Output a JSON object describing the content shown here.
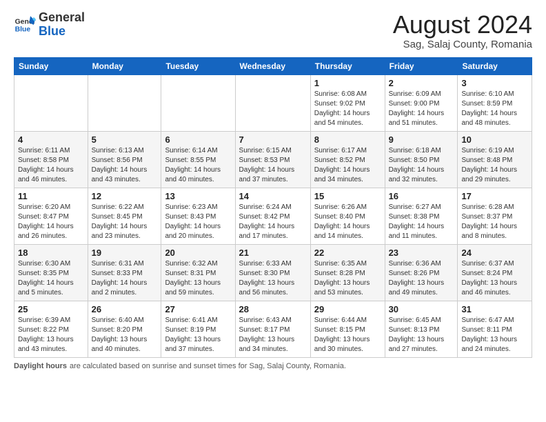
{
  "header": {
    "logo_general": "General",
    "logo_blue": "Blue",
    "month_year": "August 2024",
    "location": "Sag, Salaj County, Romania"
  },
  "days_of_week": [
    "Sunday",
    "Monday",
    "Tuesday",
    "Wednesday",
    "Thursday",
    "Friday",
    "Saturday"
  ],
  "weeks": [
    [
      {
        "day": "",
        "info": ""
      },
      {
        "day": "",
        "info": ""
      },
      {
        "day": "",
        "info": ""
      },
      {
        "day": "",
        "info": ""
      },
      {
        "day": "1",
        "info": "Sunrise: 6:08 AM\nSunset: 9:02 PM\nDaylight: 14 hours and 54 minutes."
      },
      {
        "day": "2",
        "info": "Sunrise: 6:09 AM\nSunset: 9:00 PM\nDaylight: 14 hours and 51 minutes."
      },
      {
        "day": "3",
        "info": "Sunrise: 6:10 AM\nSunset: 8:59 PM\nDaylight: 14 hours and 48 minutes."
      }
    ],
    [
      {
        "day": "4",
        "info": "Sunrise: 6:11 AM\nSunset: 8:58 PM\nDaylight: 14 hours and 46 minutes."
      },
      {
        "day": "5",
        "info": "Sunrise: 6:13 AM\nSunset: 8:56 PM\nDaylight: 14 hours and 43 minutes."
      },
      {
        "day": "6",
        "info": "Sunrise: 6:14 AM\nSunset: 8:55 PM\nDaylight: 14 hours and 40 minutes."
      },
      {
        "day": "7",
        "info": "Sunrise: 6:15 AM\nSunset: 8:53 PM\nDaylight: 14 hours and 37 minutes."
      },
      {
        "day": "8",
        "info": "Sunrise: 6:17 AM\nSunset: 8:52 PM\nDaylight: 14 hours and 34 minutes."
      },
      {
        "day": "9",
        "info": "Sunrise: 6:18 AM\nSunset: 8:50 PM\nDaylight: 14 hours and 32 minutes."
      },
      {
        "day": "10",
        "info": "Sunrise: 6:19 AM\nSunset: 8:48 PM\nDaylight: 14 hours and 29 minutes."
      }
    ],
    [
      {
        "day": "11",
        "info": "Sunrise: 6:20 AM\nSunset: 8:47 PM\nDaylight: 14 hours and 26 minutes."
      },
      {
        "day": "12",
        "info": "Sunrise: 6:22 AM\nSunset: 8:45 PM\nDaylight: 14 hours and 23 minutes."
      },
      {
        "day": "13",
        "info": "Sunrise: 6:23 AM\nSunset: 8:43 PM\nDaylight: 14 hours and 20 minutes."
      },
      {
        "day": "14",
        "info": "Sunrise: 6:24 AM\nSunset: 8:42 PM\nDaylight: 14 hours and 17 minutes."
      },
      {
        "day": "15",
        "info": "Sunrise: 6:26 AM\nSunset: 8:40 PM\nDaylight: 14 hours and 14 minutes."
      },
      {
        "day": "16",
        "info": "Sunrise: 6:27 AM\nSunset: 8:38 PM\nDaylight: 14 hours and 11 minutes."
      },
      {
        "day": "17",
        "info": "Sunrise: 6:28 AM\nSunset: 8:37 PM\nDaylight: 14 hours and 8 minutes."
      }
    ],
    [
      {
        "day": "18",
        "info": "Sunrise: 6:30 AM\nSunset: 8:35 PM\nDaylight: 14 hours and 5 minutes."
      },
      {
        "day": "19",
        "info": "Sunrise: 6:31 AM\nSunset: 8:33 PM\nDaylight: 14 hours and 2 minutes."
      },
      {
        "day": "20",
        "info": "Sunrise: 6:32 AM\nSunset: 8:31 PM\nDaylight: 13 hours and 59 minutes."
      },
      {
        "day": "21",
        "info": "Sunrise: 6:33 AM\nSunset: 8:30 PM\nDaylight: 13 hours and 56 minutes."
      },
      {
        "day": "22",
        "info": "Sunrise: 6:35 AM\nSunset: 8:28 PM\nDaylight: 13 hours and 53 minutes."
      },
      {
        "day": "23",
        "info": "Sunrise: 6:36 AM\nSunset: 8:26 PM\nDaylight: 13 hours and 49 minutes."
      },
      {
        "day": "24",
        "info": "Sunrise: 6:37 AM\nSunset: 8:24 PM\nDaylight: 13 hours and 46 minutes."
      }
    ],
    [
      {
        "day": "25",
        "info": "Sunrise: 6:39 AM\nSunset: 8:22 PM\nDaylight: 13 hours and 43 minutes."
      },
      {
        "day": "26",
        "info": "Sunrise: 6:40 AM\nSunset: 8:20 PM\nDaylight: 13 hours and 40 minutes."
      },
      {
        "day": "27",
        "info": "Sunrise: 6:41 AM\nSunset: 8:19 PM\nDaylight: 13 hours and 37 minutes."
      },
      {
        "day": "28",
        "info": "Sunrise: 6:43 AM\nSunset: 8:17 PM\nDaylight: 13 hours and 34 minutes."
      },
      {
        "day": "29",
        "info": "Sunrise: 6:44 AM\nSunset: 8:15 PM\nDaylight: 13 hours and 30 minutes."
      },
      {
        "day": "30",
        "info": "Sunrise: 6:45 AM\nSunset: 8:13 PM\nDaylight: 13 hours and 27 minutes."
      },
      {
        "day": "31",
        "info": "Sunrise: 6:47 AM\nSunset: 8:11 PM\nDaylight: 13 hours and 24 minutes."
      }
    ]
  ],
  "footer": {
    "label": "Daylight hours",
    "text": "are calculated based on sunrise and sunset times for Sag, Salaj County, Romania."
  }
}
